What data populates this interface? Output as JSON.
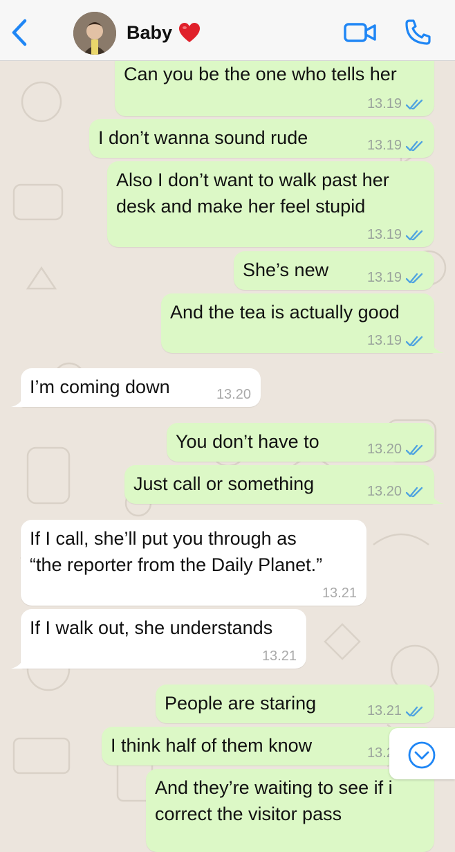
{
  "header": {
    "contact_name": "Baby",
    "heart_emoji": "❤️",
    "icons": {
      "back": "chevron-left-icon",
      "video": "video-camera-icon",
      "call": "phone-icon"
    },
    "accent_color": "#1f86f5"
  },
  "messages": [
    {
      "dir": "out",
      "text": "Can you be the one who tells her",
      "time": "13.19",
      "status": "read"
    },
    {
      "dir": "out",
      "text": "I don’t wanna sound rude",
      "time": "13.19",
      "status": "read"
    },
    {
      "dir": "out",
      "text": "Also I don’t want to walk past her\ndesk and make her feel stupid",
      "time": "13.19",
      "status": "read"
    },
    {
      "dir": "out",
      "text": "She’s new",
      "time": "13.19",
      "status": "read"
    },
    {
      "dir": "out",
      "text": "And the tea is actually good",
      "time": "13.19",
      "status": "read"
    },
    {
      "dir": "in",
      "text": "I’m coming down",
      "time": "13.20"
    },
    {
      "dir": "out",
      "text": "You don’t have to",
      "time": "13.20",
      "status": "read"
    },
    {
      "dir": "out",
      "text": "Just call or something",
      "time": "13.20",
      "status": "read"
    },
    {
      "dir": "in",
      "text": "If I call, she’ll put you through as\n“the reporter from the Daily Planet.”",
      "time": "13.21"
    },
    {
      "dir": "in",
      "text": "If I walk out, she understands",
      "time": "13.21"
    },
    {
      "dir": "out",
      "text": "People are staring",
      "time": "13.21",
      "status": "read"
    },
    {
      "dir": "out",
      "text": "I think half of them know",
      "time": "13.21",
      "status": "read"
    },
    {
      "dir": "out",
      "text": "And they’re waiting to see if i\ncorrect the visitor pass",
      "time": "",
      "status": ""
    }
  ],
  "scroll_button": {
    "icon": "chevron-down-circle-icon"
  },
  "colors": {
    "outgoing_bubble": "#dcf8c6",
    "incoming_bubble": "#ffffff",
    "chat_background": "#ece5dd",
    "read_ticks": "#4fa3e0"
  }
}
